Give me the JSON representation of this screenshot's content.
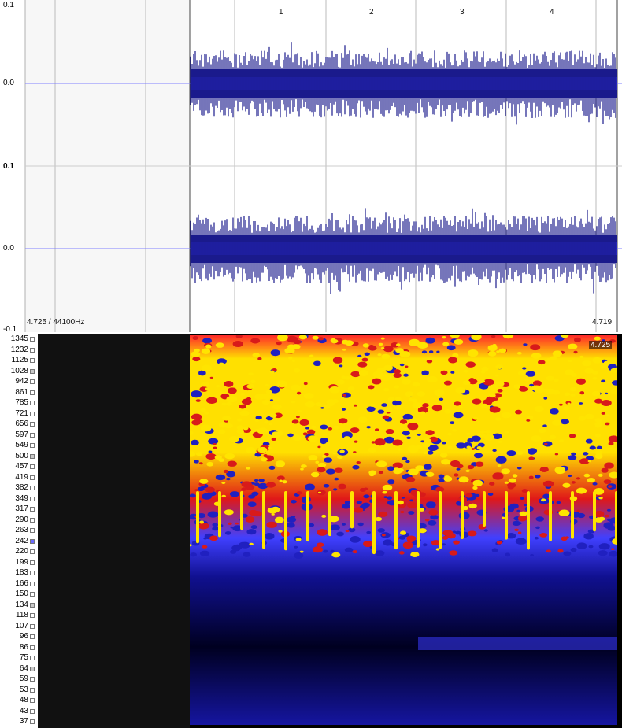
{
  "waveform": {
    "y_labels_top": [
      "0.1",
      "0.0"
    ],
    "y_labels_bottom": [
      "0.1",
      "0.0",
      "-0.1"
    ],
    "time_marks": [
      "1",
      "2",
      "3",
      "4"
    ],
    "position_readout": "4.725 / 44100Hz",
    "end_readout": "4.719",
    "channels": 2,
    "wave_color": "#1a1a8c",
    "center_line_color": "#8080ff"
  },
  "spectrogram": {
    "frequency_labels": [
      "1345",
      "1232",
      "1125",
      "1028",
      "942",
      "861",
      "785",
      "721",
      "656",
      "597",
      "549",
      "500",
      "457",
      "419",
      "382",
      "349",
      "317",
      "290",
      "263",
      "242",
      "220",
      "199",
      "183",
      "166",
      "150",
      "134",
      "118",
      "107",
      "96",
      "86",
      "75",
      "64",
      "59",
      "53",
      "48",
      "43",
      "37"
    ],
    "cursor_readout": "4.725",
    "colormap": [
      "#000000",
      "#1010a0",
      "#3a3aff",
      "#d01818",
      "#ffe000"
    ]
  }
}
